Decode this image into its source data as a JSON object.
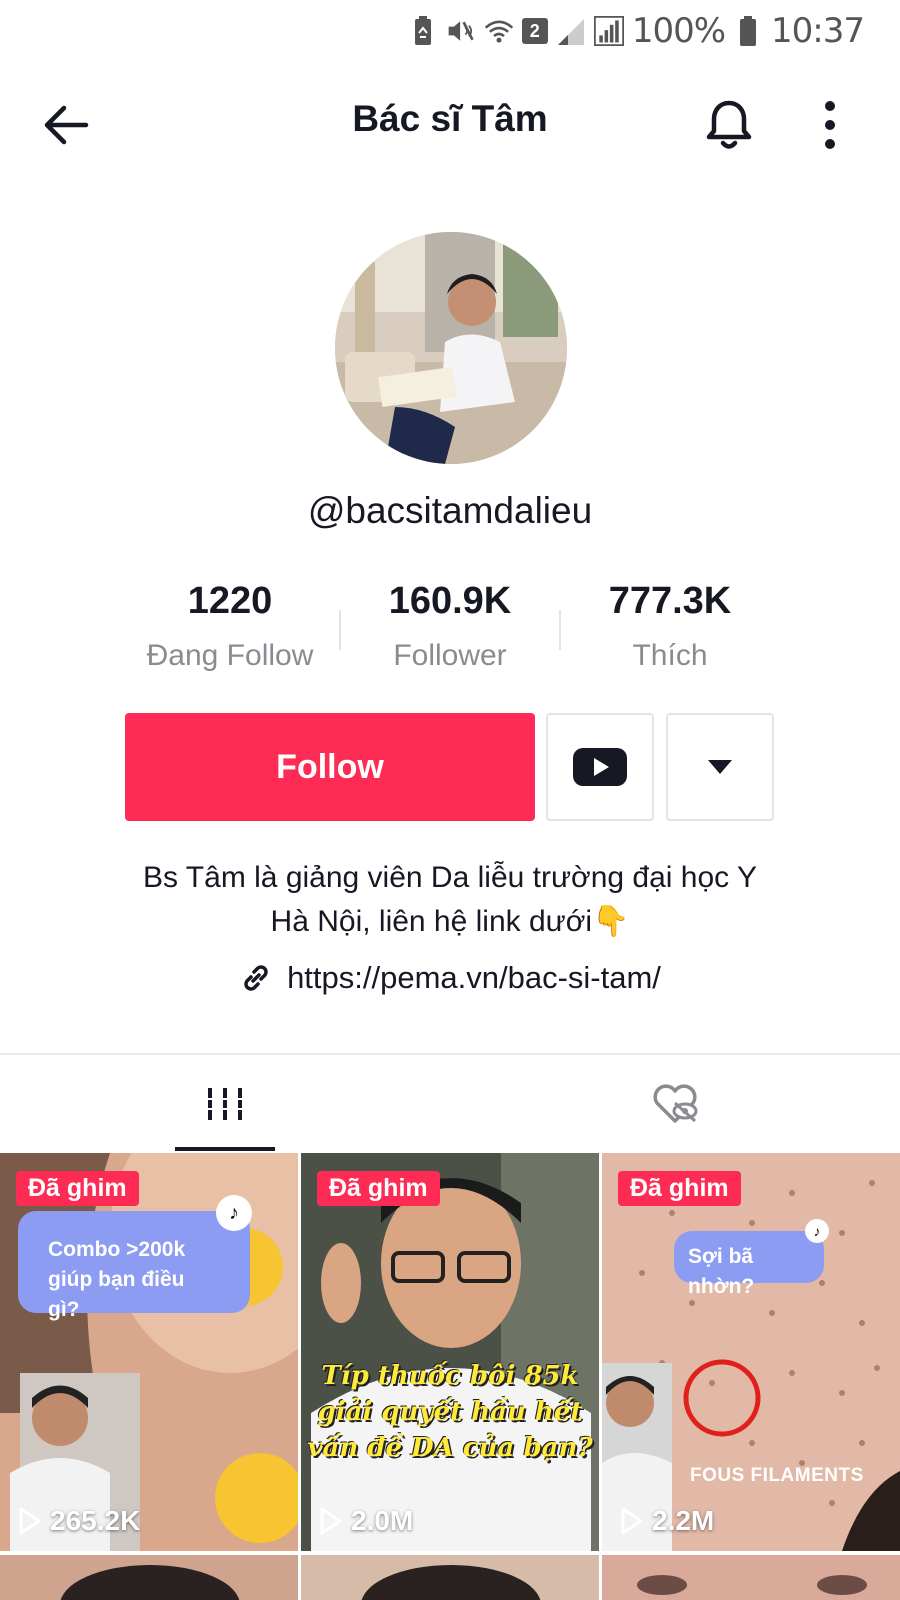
{
  "status_bar": {
    "sim_number": "2",
    "battery": "100%",
    "time": "10:37"
  },
  "header": {
    "title": "Bác sĩ Tâm"
  },
  "profile": {
    "username": "@bacsitamdalieu",
    "stats": [
      {
        "value": "1220",
        "label": "Đang Follow"
      },
      {
        "value": "160.9K",
        "label": "Follower"
      },
      {
        "value": "777.3K",
        "label": "Thích"
      }
    ],
    "follow_label": "Follow",
    "bio_line1": "Bs Tâm là giảng viên Da liễu trường đại học Y",
    "bio_line2": "Hà Nội, liên hệ link dưới👇",
    "link": "https://pema.vn/bac-si-tam/"
  },
  "tabs": [
    {
      "icon": "grid-icon",
      "active": true
    },
    {
      "icon": "liked-hidden-icon",
      "active": false
    }
  ],
  "videos": [
    {
      "pinned_label": "Đã ghim",
      "views": "265.2K",
      "overlay_text": "Combo >200k giúp bạn điều gì?"
    },
    {
      "pinned_label": "Đã ghim",
      "views": "2.0M",
      "overlay_text": "Típ thuốc bôi 85k giải quyết hầu hết vấn đề DA của bạn?"
    },
    {
      "pinned_label": "Đã ghim",
      "views": "2.2M",
      "overlay_text": "Sợi bã nhờn?",
      "overlay_label2": "FOUS FILAMENTS"
    }
  ],
  "colors": {
    "accent": "#fe2c55",
    "text": "#161823",
    "muted": "#8a8b91",
    "bubble": "#8c9cf3"
  }
}
